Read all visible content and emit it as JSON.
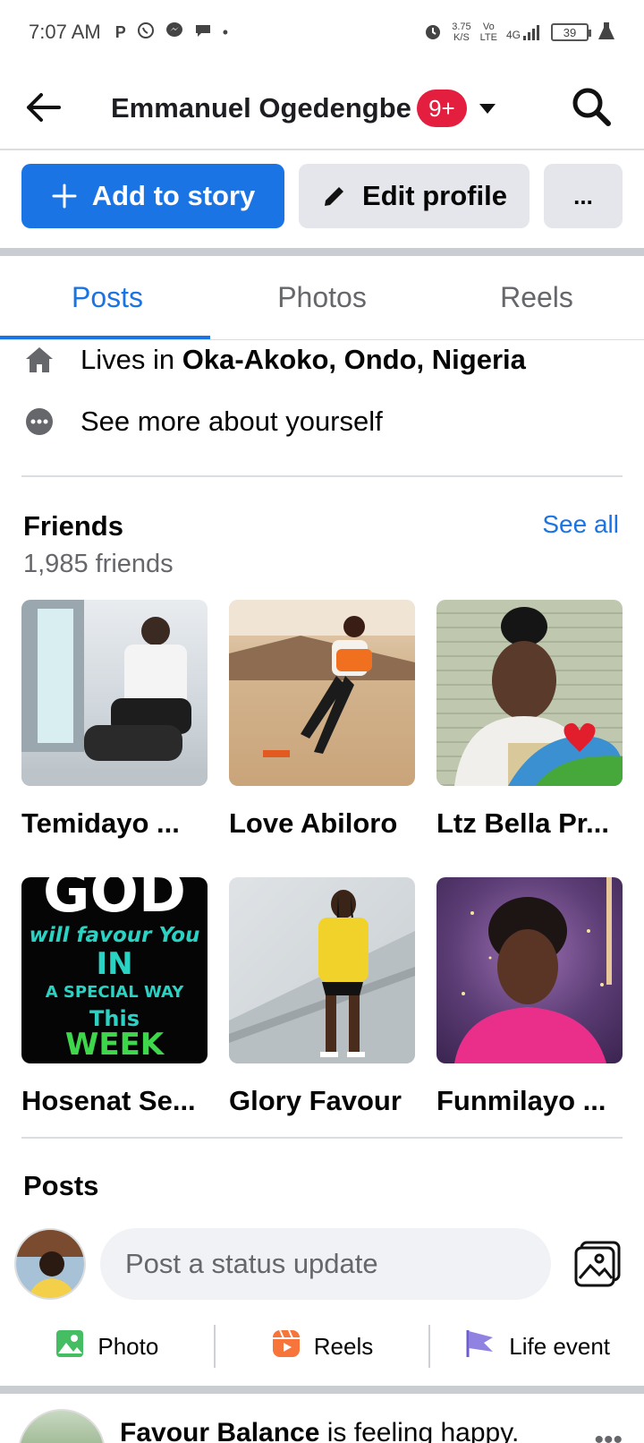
{
  "status_bar": {
    "time": "7:07 AM",
    "speed_value": "3.75",
    "speed_unit": "K/S",
    "network_vo": "Vo",
    "network_lte": "LTE",
    "network_4g": "4G",
    "battery": "39"
  },
  "header": {
    "title": "Emmanuel Ogedengbe",
    "notification_badge": "9+"
  },
  "actions": {
    "add_story": "Add to story",
    "edit_profile": "Edit profile",
    "more": "..."
  },
  "tabs": [
    {
      "label": "Posts",
      "active": true
    },
    {
      "label": "Photos",
      "active": false
    },
    {
      "label": "Reels",
      "active": false
    }
  ],
  "about": {
    "lives_prefix": "Lives in ",
    "lives_place": "Oka-Akoko, Ondo, Nigeria",
    "see_more": "See more about yourself"
  },
  "friends": {
    "title": "Friends",
    "count": "1,985 friends",
    "see_all": "See all",
    "items": [
      {
        "name": "Temidayo ..."
      },
      {
        "name": "Love Abiloro"
      },
      {
        "name": "Ltz Bella Pr..."
      },
      {
        "name": "Hosenat Se..."
      },
      {
        "name": "Glory Favour"
      },
      {
        "name": "Funmilayo ..."
      }
    ],
    "photo_texts": {
      "god": "GOD",
      "will_favour": "will favour You",
      "in": "IN",
      "special_way": "A SPECIAL WAY",
      "this": "This",
      "week": "WEEK"
    }
  },
  "posts_section": {
    "title": "Posts",
    "status_placeholder": "Post a status update",
    "composer_actions": [
      "Photo",
      "Reels",
      "Life event"
    ]
  },
  "feed_post": {
    "author": "Favour Balance",
    "action_text": " is feeling happy.",
    "more": "•••"
  },
  "colors": {
    "primary": "#1b74e4",
    "badge": "#e41e3f",
    "secondary_button": "#e4e6eb"
  }
}
